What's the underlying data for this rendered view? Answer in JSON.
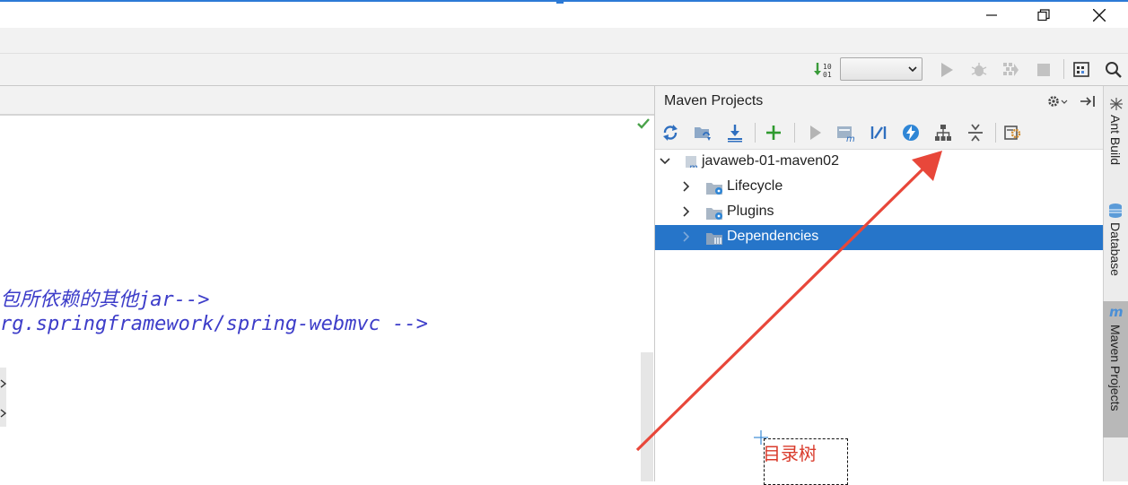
{
  "window": {
    "controls": {
      "minimize": "minimize-icon",
      "restore": "restore-icon",
      "close": "close-icon"
    }
  },
  "toolbar": {
    "icons": [
      "sort-digits-icon",
      "run-icon",
      "debug-icon",
      "coverage-icon",
      "stop-icon",
      "project-structure-icon",
      "search-icon"
    ],
    "run_config_value": ""
  },
  "editor": {
    "lines": [
      "包所依赖的其他jar-->",
      "rg.springframework/spring-webmvc -->"
    ]
  },
  "maven_panel": {
    "title": "Maven Projects",
    "toolbar_icons": [
      "reimport-icon",
      "generate-sources-icon",
      "download-icon",
      "add-icon",
      "run-icon",
      "execute-goal-icon",
      "toggle-offline-icon",
      "skip-tests-icon",
      "show-dependencies-icon",
      "collapse-all-icon",
      "settings-icon"
    ],
    "tree": {
      "root": "javaweb-01-maven02",
      "children": [
        "Lifecycle",
        "Plugins",
        "Dependencies"
      ],
      "selected": "Dependencies"
    }
  },
  "side_tabs": [
    "Ant Build",
    "Database",
    "Maven Projects"
  ],
  "annotation": {
    "text": "目录树",
    "color": "#d93a2b"
  },
  "colors": {
    "selection": "#2675c9",
    "accent": "#2c7ad6",
    "code": "#3d3dc9",
    "arrow": "#e8473a"
  }
}
